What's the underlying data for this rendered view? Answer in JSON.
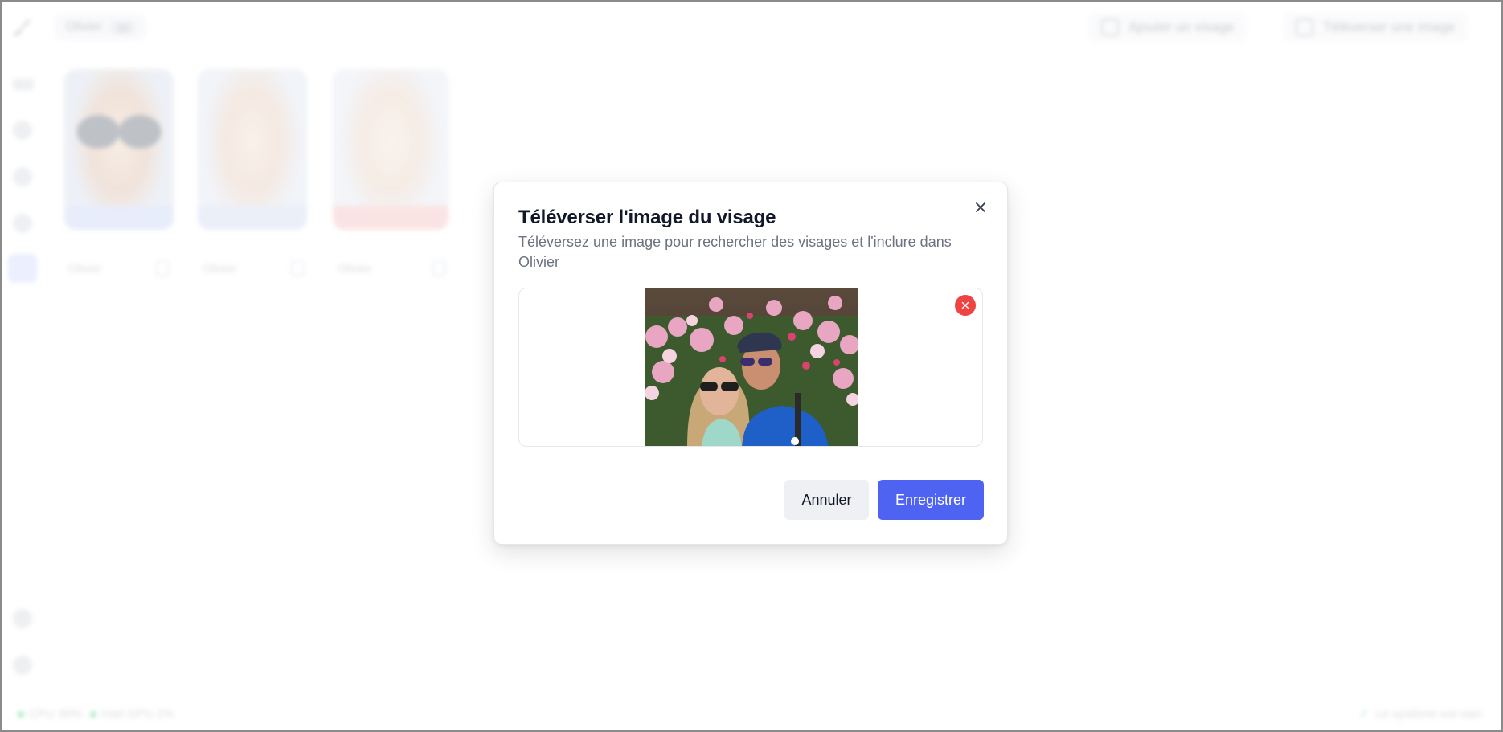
{
  "app": {
    "person_chip": {
      "name": "Olivier",
      "count": "10"
    },
    "add_face_label": "Ajouter un visage",
    "upload_image_label": "Téléverser une image",
    "faces": [
      {
        "name": "Olivier"
      },
      {
        "name": "Olivier"
      },
      {
        "name": "Olivier"
      }
    ],
    "status": {
      "cpu": "CPU 30%",
      "gpu": "Intel GPU 2%",
      "health": "Le système est sain"
    }
  },
  "dialog": {
    "title": "Téléverser l'image du visage",
    "description": "Téléversez une image pour rechercher des visages et l'inclure dans Olivier",
    "cancel_label": "Annuler",
    "save_label": "Enregistrer"
  },
  "colors": {
    "primary": "#4f63f2",
    "remove": "#ef4444",
    "muted_text": "#6b7280"
  }
}
